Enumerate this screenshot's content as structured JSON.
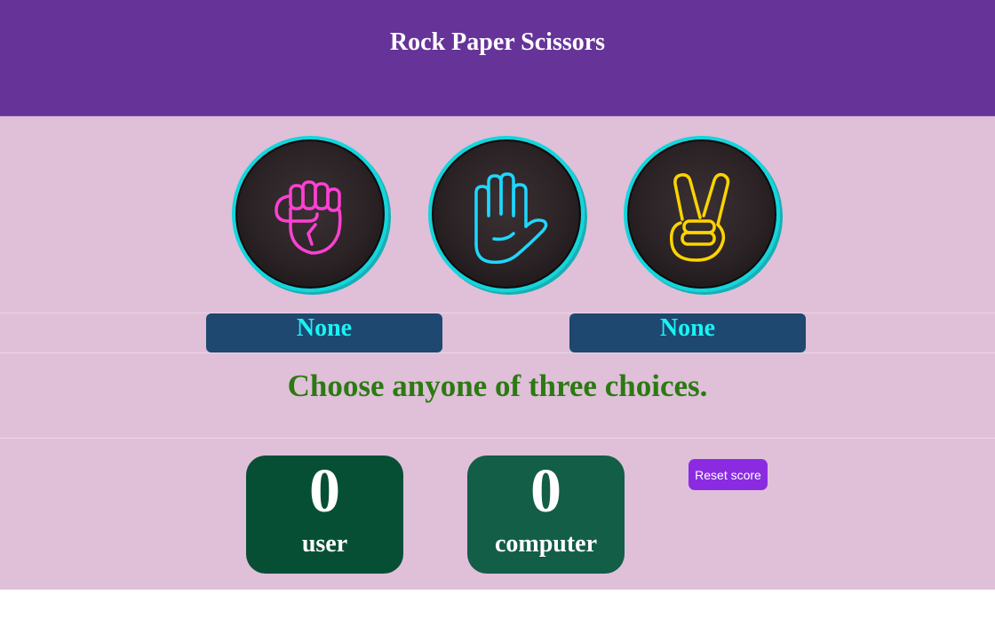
{
  "header": {
    "title": "Rock Paper Scissors"
  },
  "choices": [
    {
      "name": "rock",
      "icon": "fist-icon",
      "color": "#ff40d4"
    },
    {
      "name": "paper",
      "icon": "open-hand-icon",
      "color": "#1ed7ff"
    },
    {
      "name": "scissors",
      "icon": "peace-sign-icon",
      "color": "#ffd400"
    }
  ],
  "picks": {
    "user": "None",
    "computer": "None"
  },
  "message": "Choose anyone of three choices.",
  "scores": {
    "user": {
      "value": "0",
      "label": "user"
    },
    "computer": {
      "value": "0",
      "label": "computer"
    }
  },
  "reset_label": "Reset score",
  "colors": {
    "header": "#663399",
    "background": "#e0bfd9",
    "ring": "#12d6dc",
    "pick_box": "#1e4870",
    "pick_text": "#19f3f3",
    "message": "#2b7a12",
    "user_score_box": "#074f34",
    "computer_score_box": "#125e46",
    "reset_button": "#8a2be2"
  }
}
